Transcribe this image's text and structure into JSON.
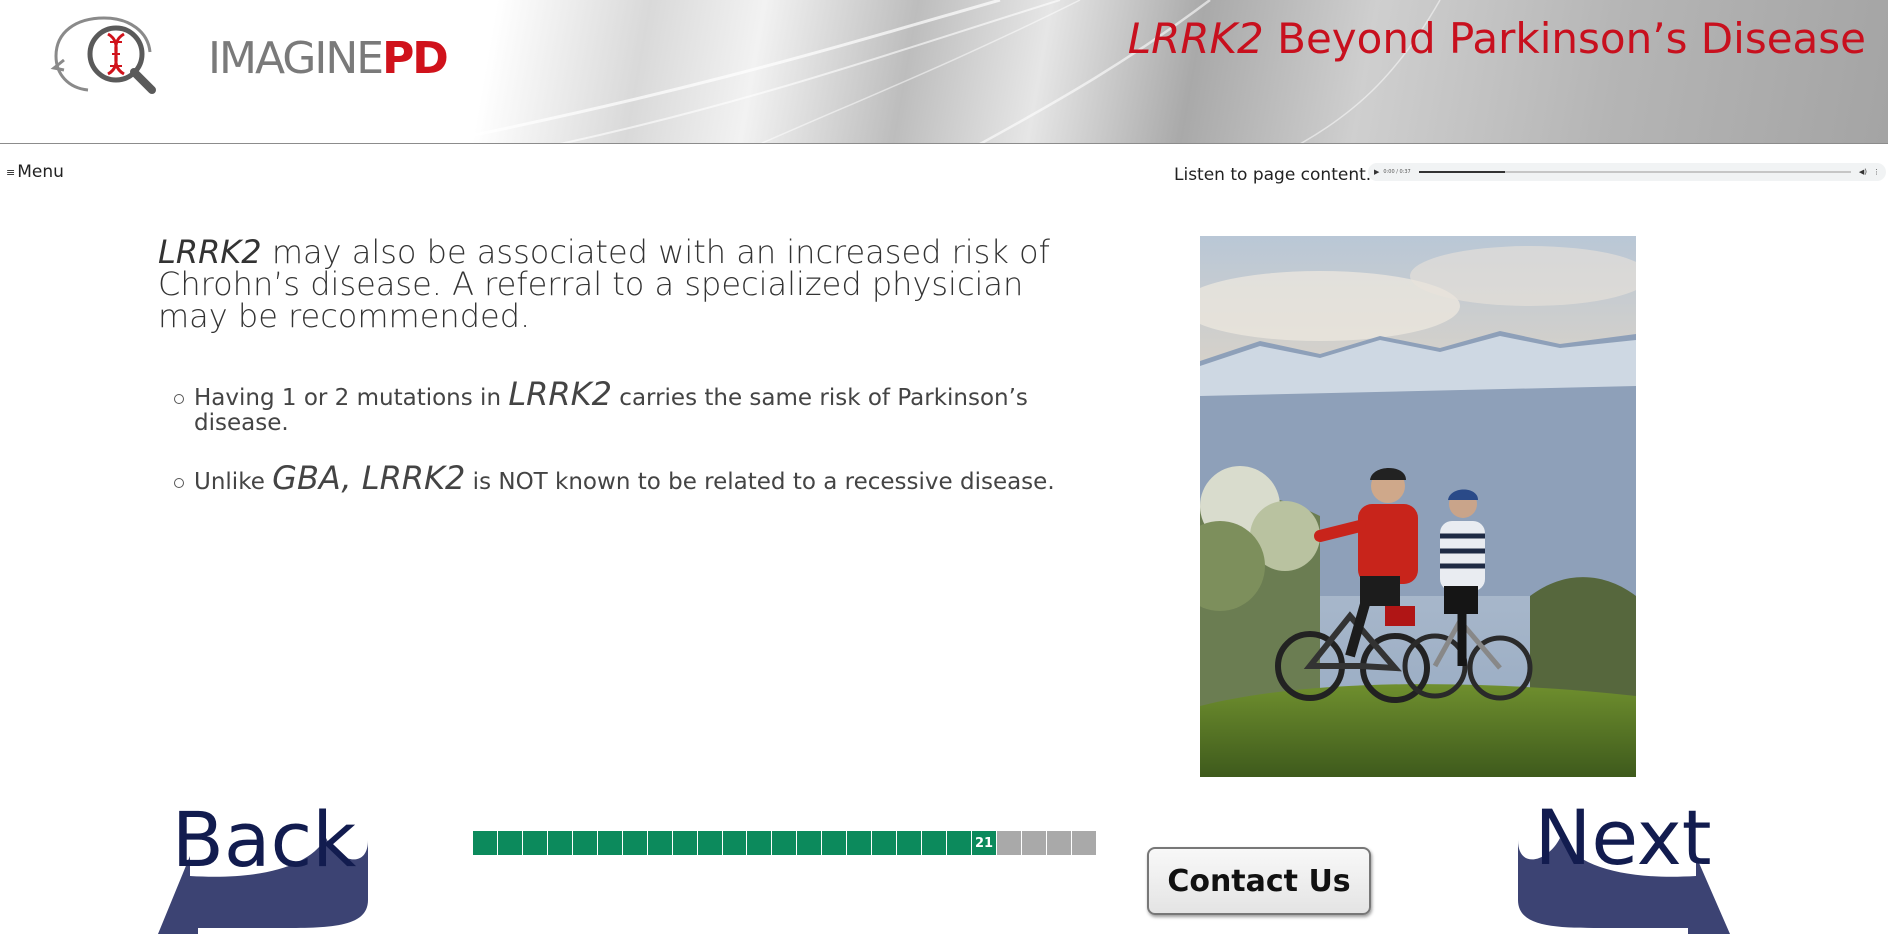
{
  "header": {
    "logo": {
      "imagine": "IMAGINE",
      "pd": "PD"
    },
    "title_italic": "LRRK2",
    "title_rest": " Beyond Parkinson’s Disease"
  },
  "toolbar": {
    "menu_label": "Menu",
    "menu_icon": "≡",
    "listen_label": "Listen to page content.",
    "audio": {
      "time": "0:00 / 0:37",
      "progress": 0.2
    }
  },
  "content": {
    "lead_italic": "LRRK2",
    "lead_rest": " may also be associated with an increased risk of Chrohn’s disease. A referral to a specialized physician may be recommended.",
    "bullets": [
      {
        "pre": "Having 1 or 2 mutations in ",
        "gene": "LRRK2",
        "post": " carries the same risk of Parkinson’s disease."
      },
      {
        "pre": "Unlike ",
        "gene": "GBA, LRRK2",
        "post": " is NOT known to be related to a recessive disease."
      }
    ]
  },
  "photo": {
    "alt": "Two cyclists on a grassy hill looking at mountains"
  },
  "nav": {
    "back_label": "Back",
    "next_label": "Next",
    "contact_label": "Contact Us",
    "accent_color": "#121c4f",
    "arrow_color": "#3c4373"
  },
  "progress": {
    "current": 21,
    "total": 25,
    "done_color": "#0c8a5c",
    "todo_color": "#a9a9a9"
  }
}
